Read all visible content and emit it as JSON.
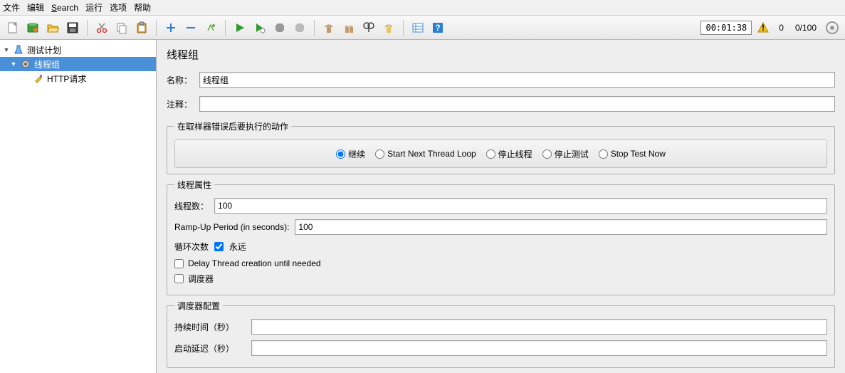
{
  "menu": {
    "file": "文件",
    "edit": "编辑",
    "search": "Search",
    "run": "运行",
    "options": "选项",
    "help": "帮助"
  },
  "status": {
    "timer": "00:01:38",
    "errors": "0",
    "progress": "0/100"
  },
  "tree": {
    "plan": "测试计划",
    "thread_group": "线程组",
    "http_request": "HTTP请求"
  },
  "panel": {
    "title": "线程组",
    "name_label": "名称：",
    "name_value": "线程组",
    "comment_label": "注释：",
    "comment_value": "",
    "on_error_legend": "在取样器错误后要执行的动作",
    "radios": {
      "continue": "继续",
      "next_loop": "Start Next Thread Loop",
      "stop_thread": "停止线程",
      "stop_test": "停止测试",
      "stop_now": "Stop Test Now"
    },
    "props_legend": "线程属性",
    "threads_label": "线程数：",
    "threads_value": "100",
    "ramp_label": "Ramp-Up Period (in seconds):",
    "ramp_value": "100",
    "loop_label": "循环次数",
    "forever_label": "永远",
    "delay_label": "Delay Thread creation until needed",
    "scheduler_label": "调度器",
    "sched_legend": "调度器配置",
    "duration_label": "持续时间（秒）",
    "duration_value": "",
    "startup_delay_label": "启动延迟（秒）",
    "startup_delay_value": ""
  }
}
